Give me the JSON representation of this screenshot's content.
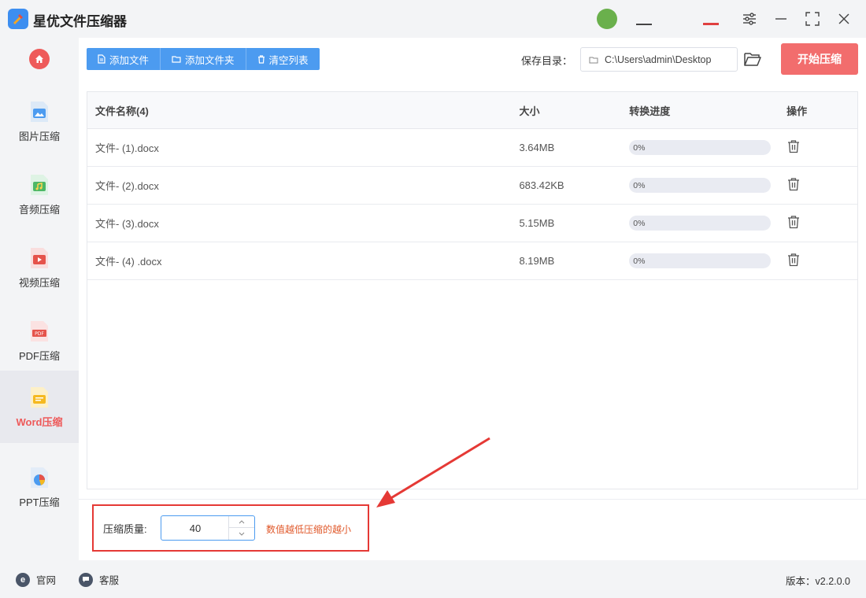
{
  "app": {
    "title": "星优文件压缩器",
    "version_label": "版本：v2.2.0.0"
  },
  "sidebar": {
    "items": [
      {
        "label": "图片压缩",
        "icon": "image-icon"
      },
      {
        "label": "音频压缩",
        "icon": "audio-icon"
      },
      {
        "label": "视频压缩",
        "icon": "video-icon"
      },
      {
        "label": "PDF压缩",
        "icon": "pdf-icon"
      },
      {
        "label": "Word压缩",
        "icon": "word-icon",
        "active": true
      },
      {
        "label": "PPT压缩",
        "icon": "ppt-icon"
      }
    ]
  },
  "toolbar": {
    "add_file": "添加文件",
    "add_folder": "添加文件夹",
    "clear_list": "清空列表",
    "save_label": "保存目录：",
    "save_path": "C:\\Users\\admin\\Desktop",
    "start_button": "开始压缩"
  },
  "table": {
    "headers": {
      "name": "文件名称(4)",
      "size": "大小",
      "progress": "转换进度",
      "action": "操作"
    },
    "rows": [
      {
        "name": "文件- (1).docx",
        "size": "3.64MB",
        "progress": "0%",
        "progress_value": 0
      },
      {
        "name": "文件- (2).docx",
        "size": "683.42KB",
        "progress": "0%",
        "progress_value": 0
      },
      {
        "name": "文件- (3).docx",
        "size": "5.15MB",
        "progress": "0%",
        "progress_value": 0
      },
      {
        "name": "文件- (4) .docx",
        "size": "8.19MB",
        "progress": "0%",
        "progress_value": 0
      }
    ]
  },
  "quality": {
    "label": "压缩质量:",
    "value": "40",
    "hint": "数值越低压缩的越小"
  },
  "statusbar": {
    "website": "官网",
    "support": "客服"
  },
  "colors": {
    "accent": "#4c9bf0",
    "brand_red": "#f26d6d",
    "highlight": "#e53935"
  }
}
